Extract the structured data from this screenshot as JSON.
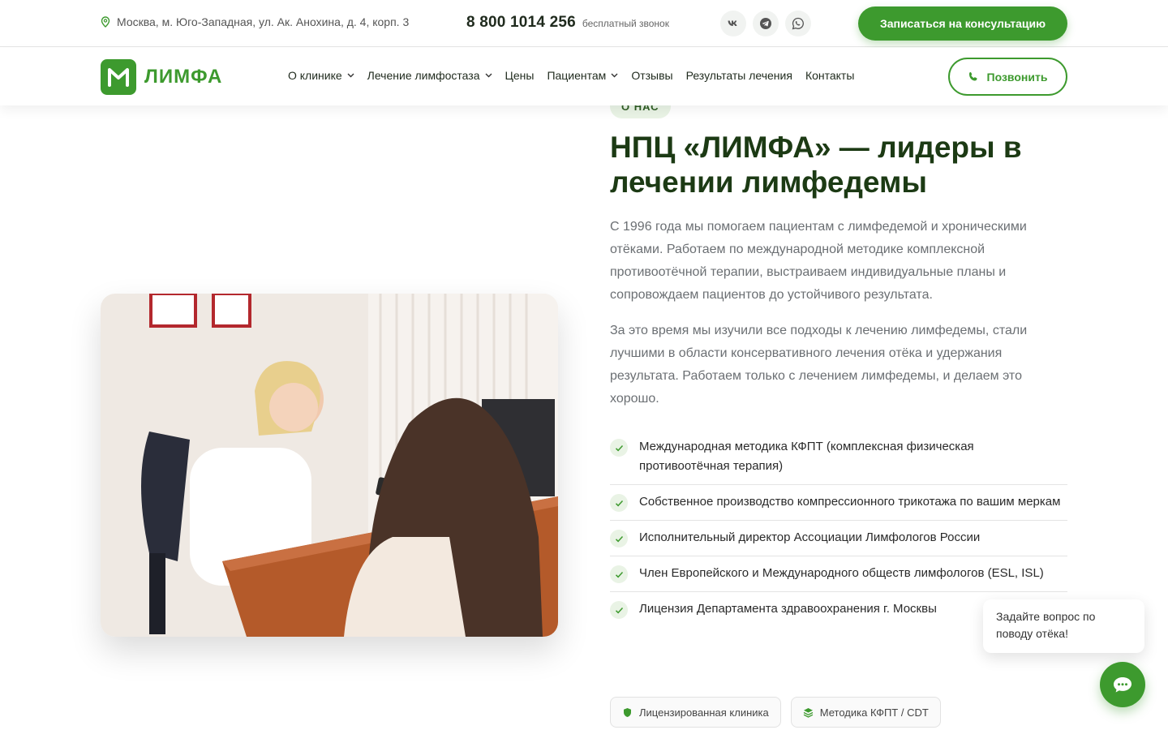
{
  "topbar": {
    "address": "Москва, м. Юго-Западная, ул. Ак. Анохина, д. 4, корп. 3",
    "phone": "8 800 1014 256",
    "phone_note": "бесплатный звонок",
    "socials": [
      "vk-icon",
      "telegram-icon",
      "whatsapp-icon"
    ],
    "cta_label": "Записаться на консультацию"
  },
  "header": {
    "logo_text": "ЛИМФА",
    "nav": [
      {
        "label": "О клинике",
        "dropdown": true
      },
      {
        "label": "Лечение лимфостаза",
        "dropdown": true
      },
      {
        "label": "Цены",
        "dropdown": false
      },
      {
        "label": "Пациентам",
        "dropdown": true
      },
      {
        "label": "Отзывы",
        "dropdown": false
      },
      {
        "label": "Результаты лечения",
        "dropdown": false
      },
      {
        "label": "Контакты",
        "dropdown": false
      }
    ],
    "call_label": "Позвонить"
  },
  "about": {
    "tag": "О НАС",
    "title": "НПЦ «ЛИМФА» — лидеры в лечении лимфедемы",
    "paragraph_1": "С 1996 года мы помогаем пациентам с лимфедемой и хроническими отёками. Работаем по международной методике комплексной противоотёчной терапии, выстраиваем индивидуальные планы и сопровождаем пациентов до устойчивого результата.",
    "paragraph_2": "За это время мы изучили все подходы к лечению лимфедемы, стали лучшими в области консервативного лечения отёка и удержания результата. Работаем только с лечением лимфедемы, и делаем это хорошо.",
    "features": [
      "Международная методика КФПТ (комплексная физическая противоотёчная терапия)",
      "Собственное производство компрессионного трикотажа по вашим меркам",
      "Исполнительный директор Ассоциации Лимфологов России",
      "Член Европейского и Международного обществ лимфологов (ESL, ISL)",
      "Лицензия Департамента здравоохранения г. Москвы"
    ],
    "badges": [
      {
        "icon": "shield-icon",
        "label": "Лицензированная клиника"
      },
      {
        "icon": "layers-icon",
        "label": "Методика КФПТ / CDT"
      }
    ]
  },
  "chat": {
    "bubble_text": "Задайте вопрос по поводу отёка!",
    "icon": "chat-icon"
  },
  "colors": {
    "brand_green": "#3d9a2e",
    "title_green": "#1c3a14",
    "tag_bg": "#e9f3e5"
  }
}
